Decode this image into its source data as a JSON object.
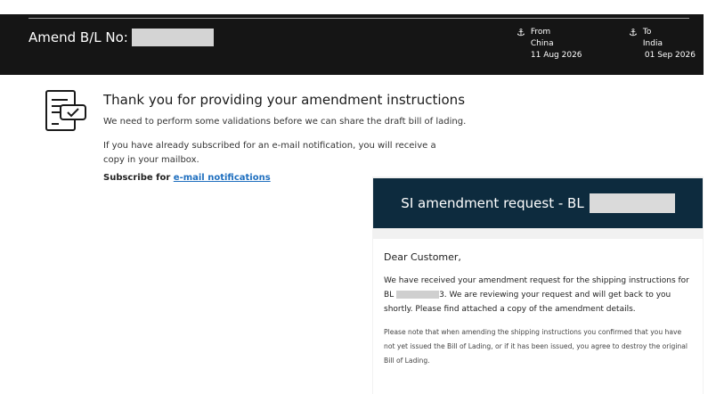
{
  "header": {
    "title": "Amend B/L No:",
    "from": {
      "label": "From",
      "place": "China",
      "date": "11 Aug 2026"
    },
    "to": {
      "label": "To",
      "place": "India",
      "date": "01 Sep 2026"
    }
  },
  "confirmation": {
    "title": "Thank you for providing your amendment instructions",
    "para1": "We need to perform some validations before we can share the draft bill of lading.",
    "para2": "If you have already subscribed for an e-mail notification, you will receive a copy in your mailbox.",
    "subscribe_prefix": "Subscribe for",
    "subscribe_link": "e-mail notifications"
  },
  "email": {
    "banner_title": "SI amendment request - BL",
    "greeting": "Dear Customer,",
    "p1_before": "We have received your amendment request for the shipping instructions for BL",
    "p1_after": "3. We are reviewing your request and will get back to you shortly. Please find attached a copy of the amendment details.",
    "p2": "Please note that when amending the shipping instructions you confirmed that you have not yet issued the Bill of Lading, or if it has been issued, you agree to destroy the original Bill of Lading."
  }
}
